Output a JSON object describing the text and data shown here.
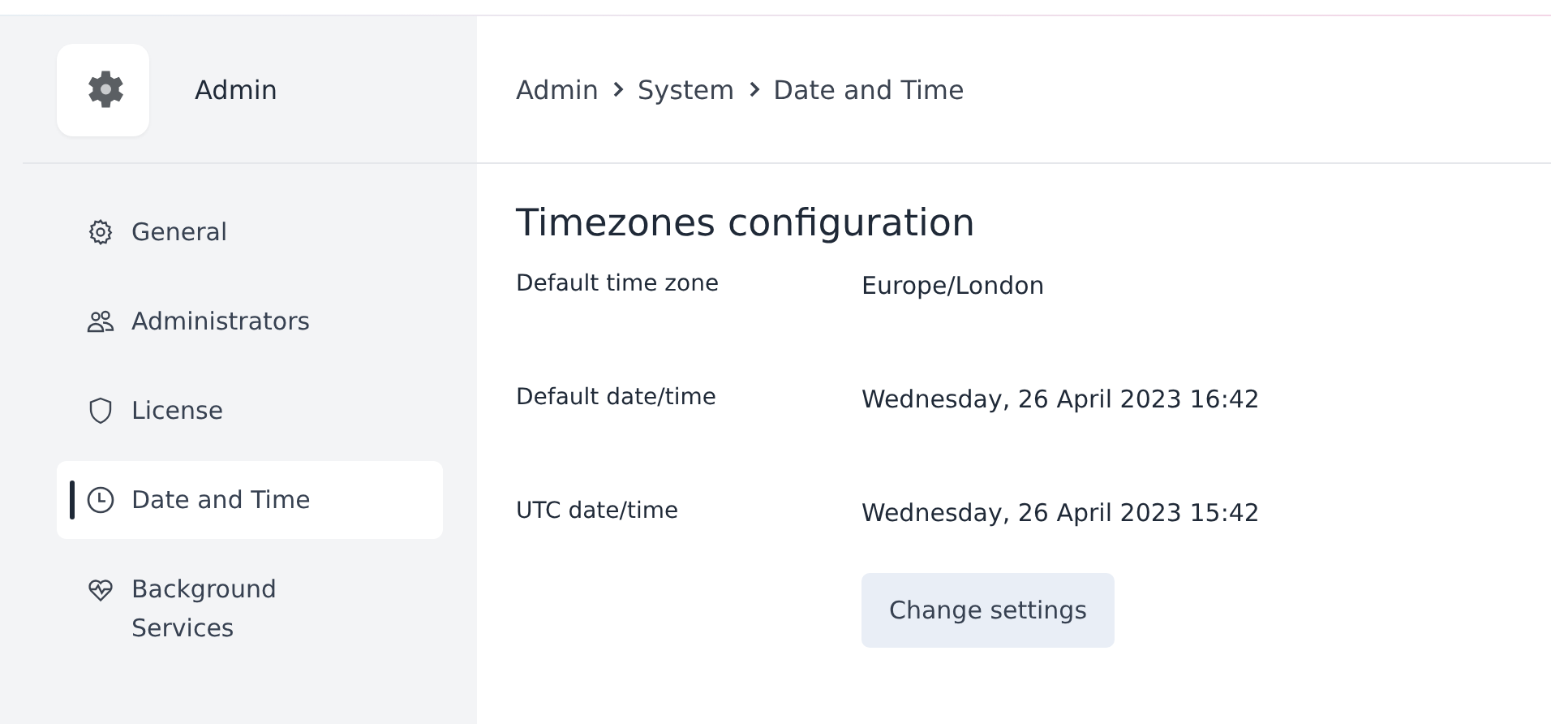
{
  "sidebar": {
    "title": "Admin",
    "items": [
      {
        "label": "General",
        "kind": "gear",
        "selected": false
      },
      {
        "label": "Administrators",
        "kind": "users",
        "selected": false
      },
      {
        "label": "License",
        "kind": "shield",
        "selected": false
      },
      {
        "label": "Date and Time",
        "kind": "clock",
        "selected": true
      },
      {
        "label": "Background Services",
        "kind": "heart",
        "selected": false
      }
    ]
  },
  "breadcrumb": [
    "Admin",
    "System",
    "Date and Time"
  ],
  "section": {
    "title": "Timezones configuration",
    "rows": [
      {
        "label": "Default time zone",
        "value": "Europe/London"
      },
      {
        "label": "Default date/time",
        "value": "Wednesday, 26 April 2023 16:42"
      },
      {
        "label": "UTC date/time",
        "value": "Wednesday, 26 April 2023 15:42"
      }
    ],
    "button": "Change settings"
  }
}
